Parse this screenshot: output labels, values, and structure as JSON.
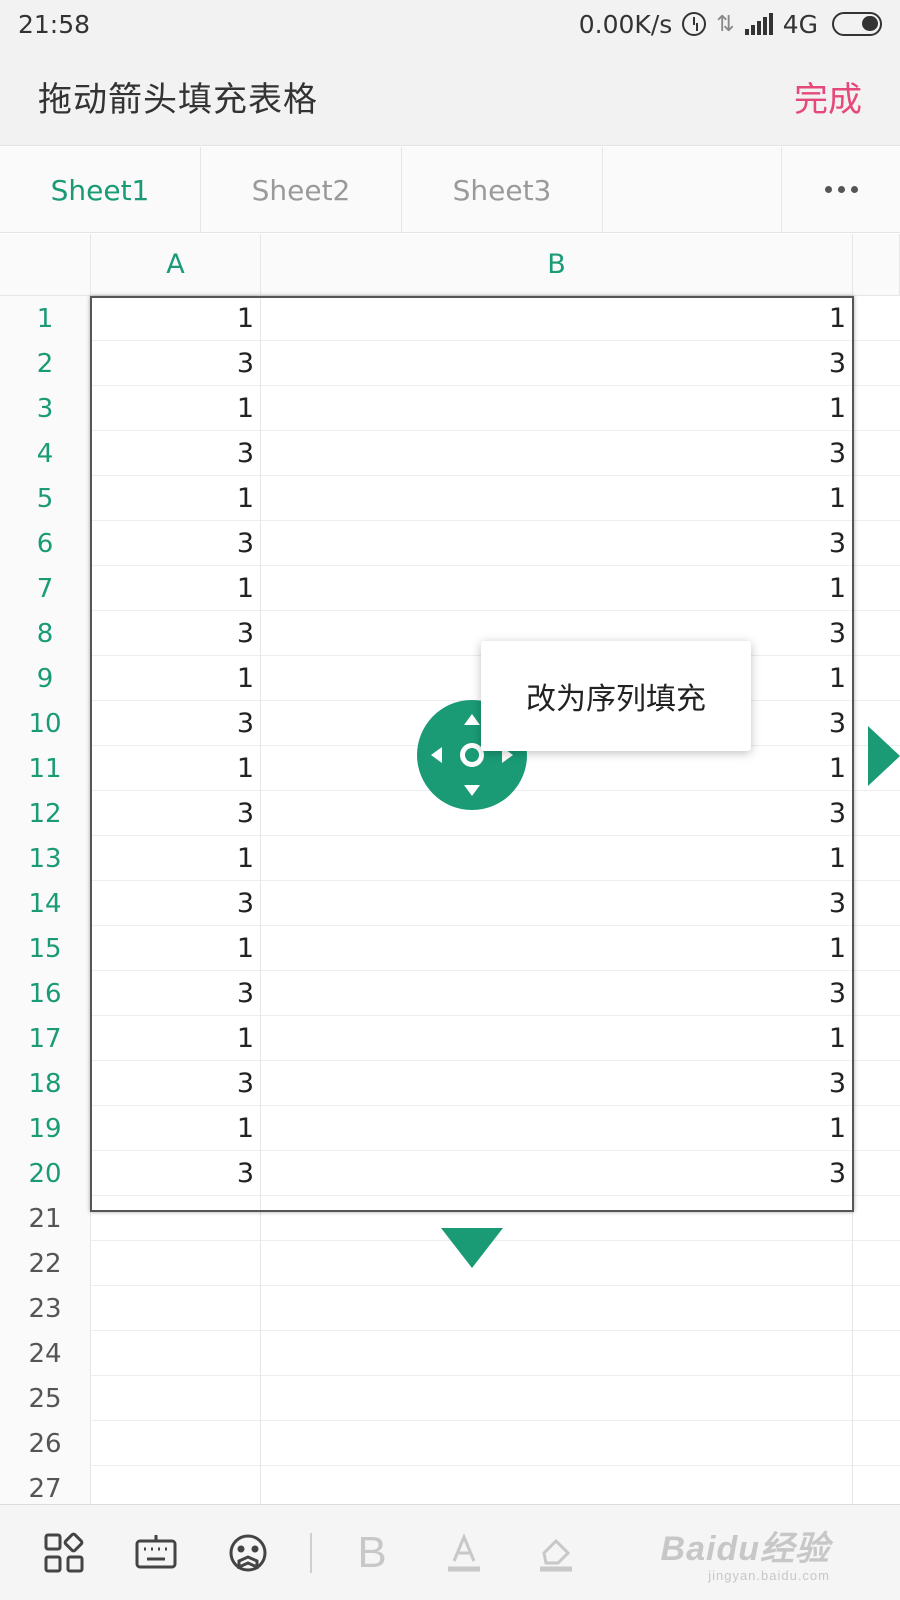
{
  "status_bar": {
    "time": "21:58",
    "net_speed": "0.00K/s",
    "network": "4G",
    "icons": [
      "alarm-icon",
      "sync-icon",
      "signal-icon",
      "battery-icon"
    ]
  },
  "header": {
    "title": "拖动箭头填充表格",
    "done_label": "完成"
  },
  "sheet_tabs": [
    {
      "label": "Sheet1",
      "active": true
    },
    {
      "label": "Sheet2",
      "active": false
    },
    {
      "label": "Sheet3",
      "active": false
    }
  ],
  "more_icon": "more-dots-icon",
  "columns": [
    "A",
    "B"
  ],
  "rows": [
    {
      "n": "1",
      "a": "1",
      "b": "1"
    },
    {
      "n": "2",
      "a": "3",
      "b": "3"
    },
    {
      "n": "3",
      "a": "1",
      "b": "1"
    },
    {
      "n": "4",
      "a": "3",
      "b": "3"
    },
    {
      "n": "5",
      "a": "1",
      "b": "1"
    },
    {
      "n": "6",
      "a": "3",
      "b": "3"
    },
    {
      "n": "7",
      "a": "1",
      "b": "1"
    },
    {
      "n": "8",
      "a": "3",
      "b": "3"
    },
    {
      "n": "9",
      "a": "1",
      "b": "1"
    },
    {
      "n": "10",
      "a": "3",
      "b": "3"
    },
    {
      "n": "11",
      "a": "1",
      "b": "1"
    },
    {
      "n": "12",
      "a": "3",
      "b": "3"
    },
    {
      "n": "13",
      "a": "1",
      "b": "1"
    },
    {
      "n": "14",
      "a": "3",
      "b": "3"
    },
    {
      "n": "15",
      "a": "1",
      "b": "1"
    },
    {
      "n": "16",
      "a": "3",
      "b": "3"
    },
    {
      "n": "17",
      "a": "1",
      "b": "1"
    },
    {
      "n": "18",
      "a": "3",
      "b": "3"
    },
    {
      "n": "19",
      "a": "1",
      "b": "1"
    },
    {
      "n": "20",
      "a": "3",
      "b": "3"
    },
    {
      "n": "21",
      "a": "",
      "b": ""
    },
    {
      "n": "22",
      "a": "",
      "b": ""
    },
    {
      "n": "23",
      "a": "",
      "b": ""
    },
    {
      "n": "24",
      "a": "",
      "b": ""
    },
    {
      "n": "25",
      "a": "",
      "b": ""
    },
    {
      "n": "26",
      "a": "",
      "b": ""
    },
    {
      "n": "27",
      "a": "",
      "b": ""
    }
  ],
  "selected_rows": 20,
  "popup": {
    "label": "改为序列填充"
  },
  "colors": {
    "accent": "#1a9b76",
    "done": "#e5497a",
    "header_bg": "#f2f2f2"
  },
  "toolbar": {
    "items": [
      "apps-grid-icon",
      "keyboard-icon",
      "emoji-icon",
      "bold-icon",
      "font-color-icon",
      "fill-color-icon"
    ],
    "bold_label": "B",
    "font_color_label": "A"
  },
  "watermark": {
    "brand": "Baidu经验",
    "url": "jingyan.baidu.com"
  }
}
